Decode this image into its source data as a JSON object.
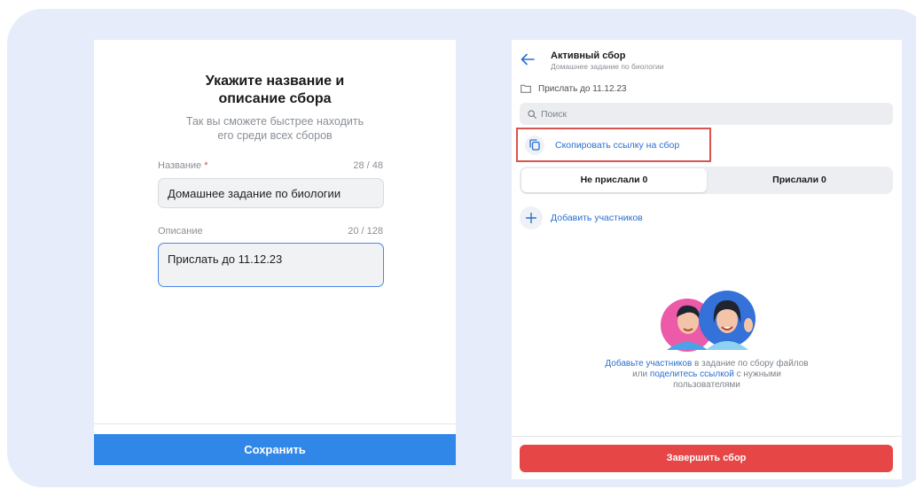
{
  "left_form": {
    "title_line1": "Укажите название и",
    "title_line2": "описание сбора",
    "subtitle_line1": "Так вы сможете быстрее находить",
    "subtitle_line2": "его среди всех сборов",
    "name_label": "Название",
    "name_required_mark": "*",
    "name_counter": "28 / 48",
    "name_value": "Домашнее задание по биологии",
    "description_label": "Описание",
    "description_counter": "20 / 128",
    "description_value": "Прислать до 11.12.23",
    "save_label": "Сохранить"
  },
  "right_panel": {
    "title": "Активный сбор",
    "subtitle": "Домашнее задание по биологии",
    "deadline": "Прислать до 11.12.23",
    "search_placeholder": "Поиск",
    "copy_link_label": "Скопировать ссылку на сбор",
    "tabs": [
      {
        "label": "Не прислали 0",
        "active": true
      },
      {
        "label": "Прислали 0",
        "active": false
      }
    ],
    "add_members_label": "Добавить участников",
    "empty_state": {
      "link1": "Добавьте участников",
      "text1": " в задание по сбору файлов",
      "text2": "или ",
      "link2": "поделитесь ссылкой",
      "text3": " с нужными",
      "text4": "пользователями"
    },
    "finish_label": "Завершить сбор"
  },
  "colors": {
    "accent_blue": "#3187e8",
    "link_blue": "#2a6fd1",
    "danger_red": "#e64646",
    "highlight_frame": "#d9534f",
    "backdrop": "#e6ecf9"
  },
  "icons": [
    "back-arrow-icon",
    "folder-icon",
    "search-icon",
    "copy-icon",
    "plus-icon"
  ]
}
